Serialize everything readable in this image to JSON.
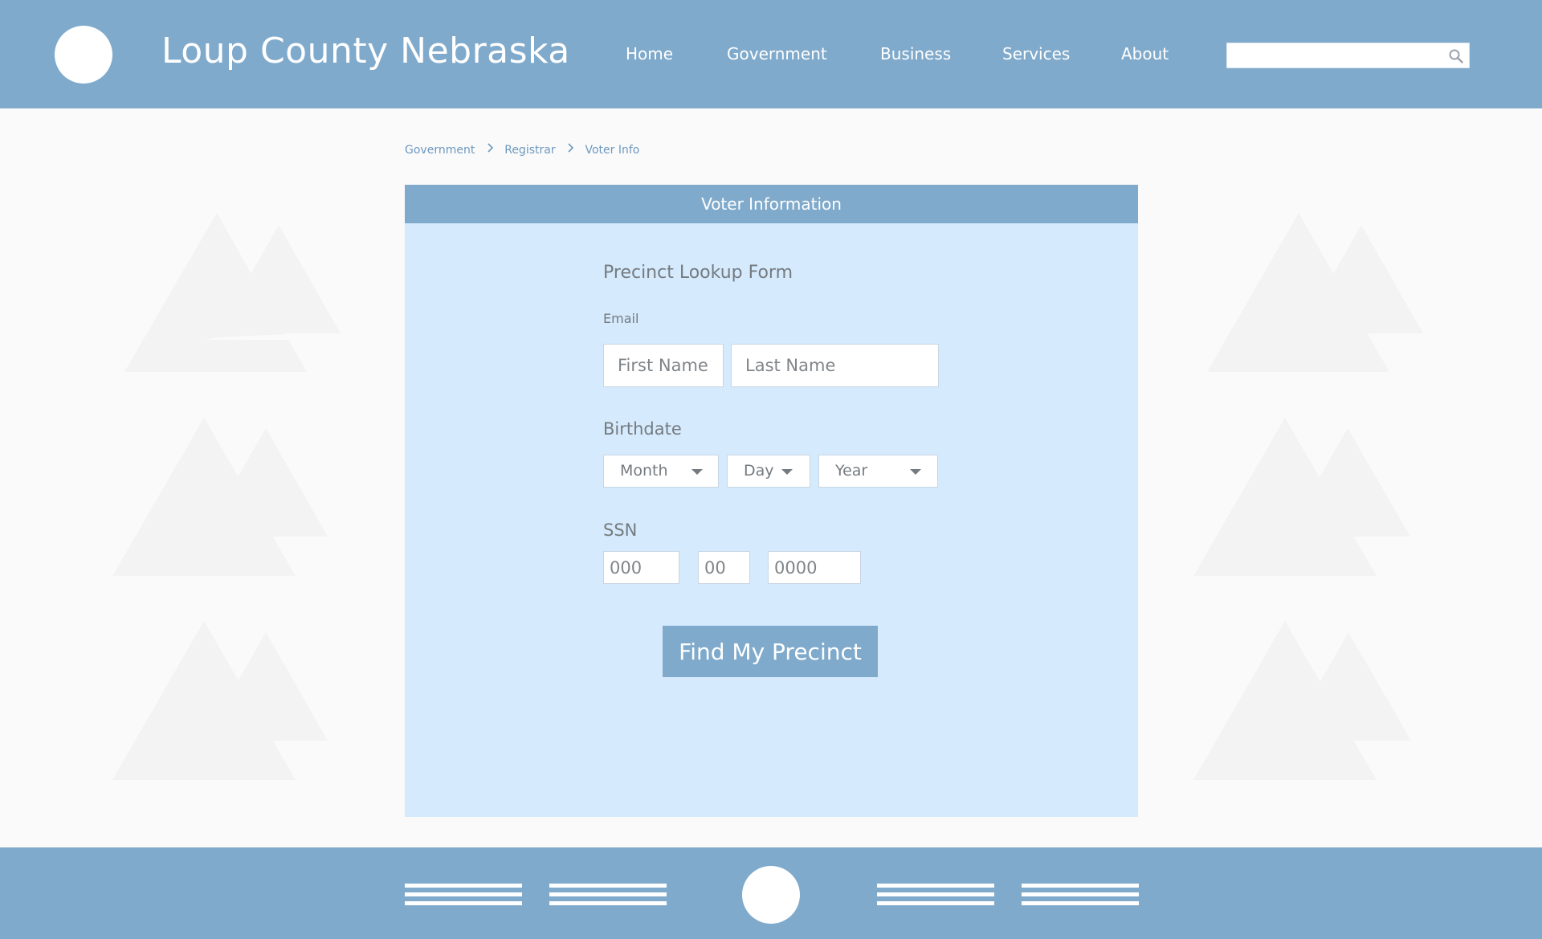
{
  "header": {
    "title": "Loup County Nebraska",
    "nav": [
      "Home",
      "Government",
      "Business",
      "Services",
      "About"
    ],
    "search_placeholder": "",
    "search_icon": "magnifier"
  },
  "breadcrumb": [
    "Government",
    "Registrar",
    "Voter Info"
  ],
  "panel": {
    "title": "Voter Information",
    "form_title": "Precinct Lookup Form",
    "email_label": "Email",
    "first_name_placeholder": "First Name",
    "last_name_placeholder": "Last Name",
    "birthdate_label": "Birthdate",
    "month_label": "Month",
    "day_label": "Day",
    "year_label": "Year",
    "ssn_label": "SSN",
    "ssn1_placeholder": "000",
    "ssn2_placeholder": "00",
    "ssn3_placeholder": "0000",
    "submit_label": "Find My Precinct"
  },
  "colors": {
    "brand": "#80aacb",
    "panel_bg": "#d5eafc",
    "page_bg": "#fafafa",
    "text_muted": "#757b80"
  }
}
